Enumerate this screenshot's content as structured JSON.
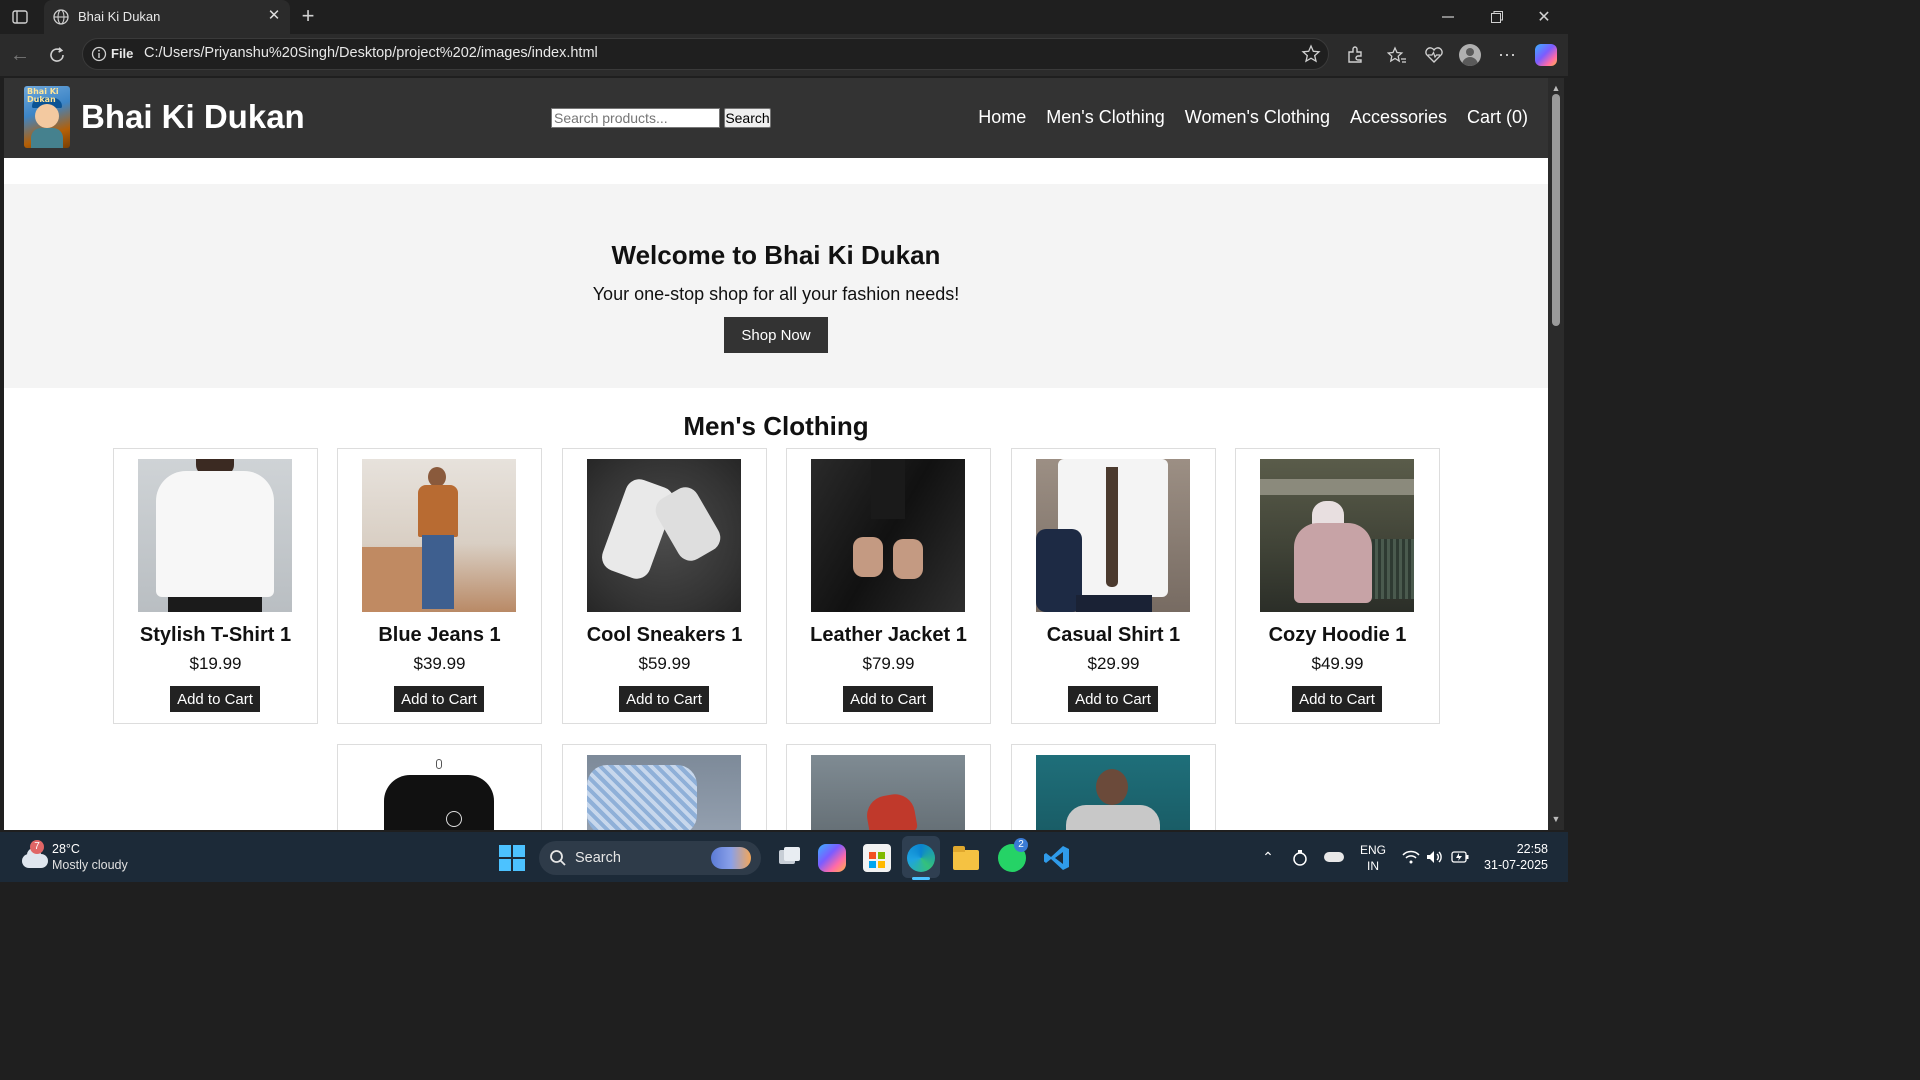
{
  "browser": {
    "tab_title": "Bhai Ki Dukan",
    "url_scheme_label": "File",
    "url": "C:/Users/Priyanshu%20Singh/Desktop/project%202/images/index.html"
  },
  "site": {
    "logo_text": "Bhai Ki Dukan",
    "title": "Bhai Ki Dukan",
    "search": {
      "placeholder": "Search products...",
      "button": "Search"
    },
    "nav": [
      "Home",
      "Men's Clothing",
      "Women's Clothing",
      "Accessories",
      "Cart (0)"
    ]
  },
  "hero": {
    "heading": "Welcome to Bhai Ki Dukan",
    "subtext": "Your one-stop shop for all your fashion needs!",
    "button": "Shop Now"
  },
  "mens_section": {
    "title": "Men's Clothing",
    "add_label": "Add to Cart",
    "products": [
      {
        "name": "Stylish T-Shirt 1",
        "price": "$19.99"
      },
      {
        "name": "Blue Jeans 1",
        "price": "$39.99"
      },
      {
        "name": "Cool Sneakers 1",
        "price": "$59.99"
      },
      {
        "name": "Leather Jacket 1",
        "price": "$79.99"
      },
      {
        "name": "Casual Shirt 1",
        "price": "$29.99"
      },
      {
        "name": "Cozy Hoodie 1",
        "price": "$49.99"
      }
    ]
  },
  "taskbar": {
    "weather_badge": "7",
    "temperature": "28°C",
    "weather": "Mostly cloudy",
    "search_label": "Search",
    "whatsapp_badge": "2",
    "language": "ENG",
    "region": "IN",
    "time": "22:58",
    "date": "31-07-2025"
  },
  "colors": {
    "header_bg": "#333333",
    "hero_bg": "#f4f4f4",
    "button_bg": "#222222"
  }
}
